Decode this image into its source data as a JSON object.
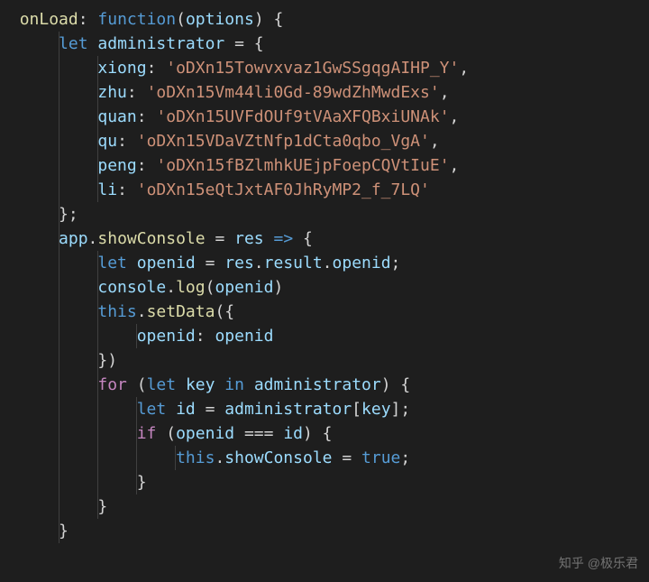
{
  "code": {
    "lines": [
      {
        "indent": 0,
        "tokens": [
          {
            "cls": "fn",
            "t": "onLoad"
          },
          {
            "cls": "punct",
            "t": ": "
          },
          {
            "cls": "kw",
            "t": "function"
          },
          {
            "cls": "punct",
            "t": "("
          },
          {
            "cls": "var",
            "t": "options"
          },
          {
            "cls": "punct",
            "t": ") {"
          }
        ]
      },
      {
        "indent": 1,
        "tokens": [
          {
            "cls": "kw",
            "t": "let"
          },
          {
            "cls": "punct",
            "t": " "
          },
          {
            "cls": "var",
            "t": "administrator"
          },
          {
            "cls": "punct",
            "t": " = {"
          }
        ]
      },
      {
        "indent": 2,
        "tokens": [
          {
            "cls": "prop",
            "t": "xiong"
          },
          {
            "cls": "punct",
            "t": ": "
          },
          {
            "cls": "str",
            "t": "'oDXn15Towvxvaz1GwSSgqgAIHP_Y'"
          },
          {
            "cls": "punct",
            "t": ","
          }
        ]
      },
      {
        "indent": 2,
        "tokens": [
          {
            "cls": "prop",
            "t": "zhu"
          },
          {
            "cls": "punct",
            "t": ": "
          },
          {
            "cls": "str",
            "t": "'oDXn15Vm44li0Gd-89wdZhMwdExs'"
          },
          {
            "cls": "punct",
            "t": ","
          }
        ]
      },
      {
        "indent": 2,
        "tokens": [
          {
            "cls": "prop",
            "t": "quan"
          },
          {
            "cls": "punct",
            "t": ": "
          },
          {
            "cls": "str",
            "t": "'oDXn15UVFdOUf9tVAaXFQBxiUNAk'"
          },
          {
            "cls": "punct",
            "t": ","
          }
        ]
      },
      {
        "indent": 2,
        "tokens": [
          {
            "cls": "prop",
            "t": "qu"
          },
          {
            "cls": "punct",
            "t": ": "
          },
          {
            "cls": "str",
            "t": "'oDXn15VDaVZtNfp1dCta0qbo_VgA'"
          },
          {
            "cls": "punct",
            "t": ","
          }
        ]
      },
      {
        "indent": 2,
        "tokens": [
          {
            "cls": "prop",
            "t": "peng"
          },
          {
            "cls": "punct",
            "t": ": "
          },
          {
            "cls": "str",
            "t": "'oDXn15fBZlmhkUEjpFoepCQVtIuE'"
          },
          {
            "cls": "punct",
            "t": ","
          }
        ]
      },
      {
        "indent": 2,
        "tokens": [
          {
            "cls": "prop",
            "t": "li"
          },
          {
            "cls": "punct",
            "t": ": "
          },
          {
            "cls": "str",
            "t": "'oDXn15eQtJxtAF0JhRyMP2_f_7LQ'"
          }
        ]
      },
      {
        "indent": 1,
        "tokens": [
          {
            "cls": "punct",
            "t": "};"
          }
        ]
      },
      {
        "indent": 1,
        "tokens": [
          {
            "cls": "var",
            "t": "app"
          },
          {
            "cls": "punct",
            "t": "."
          },
          {
            "cls": "fn",
            "t": "showConsole"
          },
          {
            "cls": "punct",
            "t": " = "
          },
          {
            "cls": "var",
            "t": "res"
          },
          {
            "cls": "punct",
            "t": " "
          },
          {
            "cls": "kw",
            "t": "=>"
          },
          {
            "cls": "punct",
            "t": " {"
          }
        ]
      },
      {
        "indent": 2,
        "tokens": [
          {
            "cls": "kw",
            "t": "let"
          },
          {
            "cls": "punct",
            "t": " "
          },
          {
            "cls": "var",
            "t": "openid"
          },
          {
            "cls": "punct",
            "t": " = "
          },
          {
            "cls": "var",
            "t": "res"
          },
          {
            "cls": "punct",
            "t": "."
          },
          {
            "cls": "var",
            "t": "result"
          },
          {
            "cls": "punct",
            "t": "."
          },
          {
            "cls": "var",
            "t": "openid"
          },
          {
            "cls": "punct",
            "t": ";"
          }
        ]
      },
      {
        "indent": 2,
        "tokens": [
          {
            "cls": "var",
            "t": "console"
          },
          {
            "cls": "punct",
            "t": "."
          },
          {
            "cls": "fn",
            "t": "log"
          },
          {
            "cls": "punct",
            "t": "("
          },
          {
            "cls": "var",
            "t": "openid"
          },
          {
            "cls": "punct",
            "t": ")"
          }
        ]
      },
      {
        "indent": 2,
        "tokens": [
          {
            "cls": "this",
            "t": "this"
          },
          {
            "cls": "punct",
            "t": "."
          },
          {
            "cls": "fn",
            "t": "setData"
          },
          {
            "cls": "punct",
            "t": "({"
          }
        ]
      },
      {
        "indent": 3,
        "tokens": [
          {
            "cls": "prop",
            "t": "openid"
          },
          {
            "cls": "punct",
            "t": ": "
          },
          {
            "cls": "var",
            "t": "openid"
          }
        ]
      },
      {
        "indent": 2,
        "tokens": [
          {
            "cls": "punct",
            "t": "})"
          }
        ]
      },
      {
        "indent": 2,
        "tokens": [
          {
            "cls": "kw2",
            "t": "for"
          },
          {
            "cls": "punct",
            "t": " ("
          },
          {
            "cls": "kw",
            "t": "let"
          },
          {
            "cls": "punct",
            "t": " "
          },
          {
            "cls": "var",
            "t": "key"
          },
          {
            "cls": "punct",
            "t": " "
          },
          {
            "cls": "kw",
            "t": "in"
          },
          {
            "cls": "punct",
            "t": " "
          },
          {
            "cls": "var",
            "t": "administrator"
          },
          {
            "cls": "punct",
            "t": ") {"
          }
        ]
      },
      {
        "indent": 3,
        "tokens": [
          {
            "cls": "kw",
            "t": "let"
          },
          {
            "cls": "punct",
            "t": " "
          },
          {
            "cls": "var",
            "t": "id"
          },
          {
            "cls": "punct",
            "t": " = "
          },
          {
            "cls": "var",
            "t": "administrator"
          },
          {
            "cls": "punct",
            "t": "["
          },
          {
            "cls": "var",
            "t": "key"
          },
          {
            "cls": "punct",
            "t": "];"
          }
        ]
      },
      {
        "indent": 3,
        "tokens": [
          {
            "cls": "kw2",
            "t": "if"
          },
          {
            "cls": "punct",
            "t": " ("
          },
          {
            "cls": "var",
            "t": "openid"
          },
          {
            "cls": "punct",
            "t": " === "
          },
          {
            "cls": "var",
            "t": "id"
          },
          {
            "cls": "punct",
            "t": ") {"
          }
        ]
      },
      {
        "indent": 4,
        "tokens": [
          {
            "cls": "this",
            "t": "this"
          },
          {
            "cls": "punct",
            "t": "."
          },
          {
            "cls": "var",
            "t": "showConsole"
          },
          {
            "cls": "punct",
            "t": " = "
          },
          {
            "cls": "kw",
            "t": "true"
          },
          {
            "cls": "punct",
            "t": ";"
          }
        ]
      },
      {
        "indent": 3,
        "tokens": [
          {
            "cls": "punct",
            "t": "}"
          }
        ]
      },
      {
        "indent": 2,
        "tokens": [
          {
            "cls": "punct",
            "t": "}"
          }
        ]
      },
      {
        "indent": 1,
        "tokens": [
          {
            "cls": "punct",
            "t": "}"
          }
        ]
      }
    ],
    "indentUnit": "    ",
    "baseIndent": "  "
  },
  "watermark": "知乎 @极乐君"
}
